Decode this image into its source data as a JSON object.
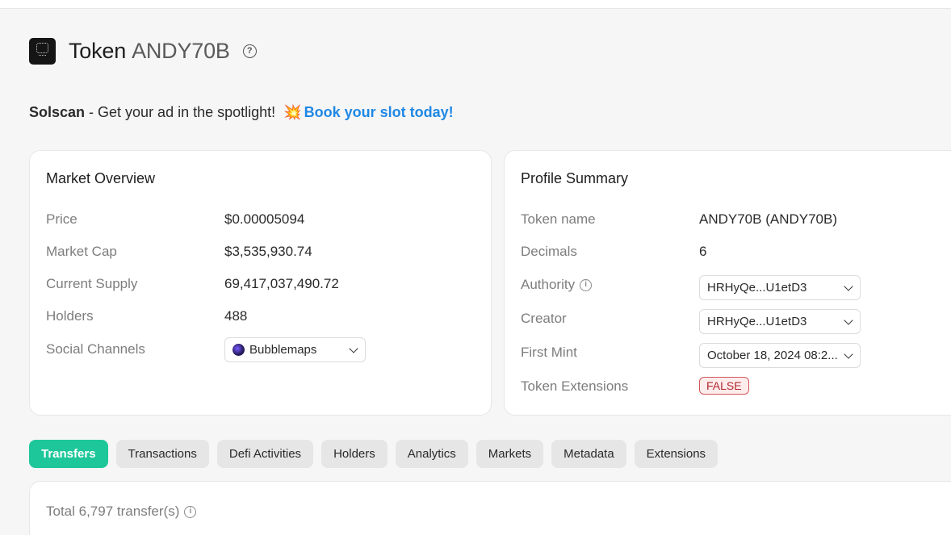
{
  "header": {
    "title_prefix": "Token",
    "title_ticker": "ANDY70B",
    "help_icon": "question-circle-icon"
  },
  "ad": {
    "brand": "Solscan",
    "text": " - Get your ad in the spotlight! ",
    "icon": "💥",
    "link": "Book your slot today!"
  },
  "market": {
    "title": "Market Overview",
    "rows": [
      {
        "label": "Price",
        "value": "$0.00005094"
      },
      {
        "label": "Market Cap",
        "value": "$3,535,930.74"
      },
      {
        "label": "Current Supply",
        "value": "69,417,037,490.72"
      },
      {
        "label": "Holders",
        "value": "488"
      },
      {
        "label": "Social Channels",
        "value": "Bubblemaps"
      }
    ]
  },
  "profile": {
    "title": "Profile Summary",
    "rows": [
      {
        "label": "Token name",
        "value": "ANDY70B (ANDY70B)"
      },
      {
        "label": "Decimals",
        "value": "6"
      },
      {
        "label": "Authority",
        "value": "HRHyQe...U1etD3"
      },
      {
        "label": "Creator",
        "value": "HRHyQe...U1etD3"
      },
      {
        "label": "First Mint",
        "value": "October 18, 2024 08:2..."
      },
      {
        "label": "Token Extensions",
        "value": "FALSE"
      }
    ]
  },
  "tabs": [
    "Transfers",
    "Transactions",
    "Defi Activities",
    "Holders",
    "Analytics",
    "Markets",
    "Metadata",
    "Extensions"
  ],
  "active_tab": "Transfers",
  "transfers": {
    "total_text": "Total 6,797 transfer(s)"
  },
  "colors": {
    "accent": "#1ec79a",
    "link": "#1e88e5",
    "false_badge": "#b1292e"
  }
}
